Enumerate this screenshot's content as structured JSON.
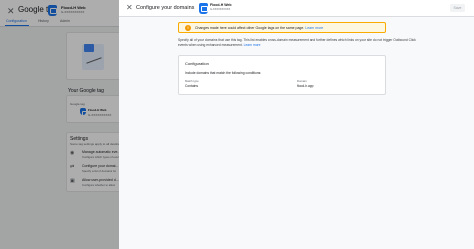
{
  "background": {
    "app_title": "Google tag",
    "site_name": "Flood-H Web",
    "site_id": "G-XXXXXXXXXX",
    "tabs": [
      {
        "label": "Configuration",
        "active": true
      },
      {
        "label": "History",
        "active": false
      },
      {
        "label": "Admin",
        "active": false
      }
    ],
    "your_tag_heading": "Your Google tag",
    "tag_id_label": "Google tag",
    "tag_name": "Flood-H Web",
    "tag_id": "G-XXXXXXXXXX",
    "settings_heading": "Settings",
    "settings_sub": "Some tag settings apply to all destinations",
    "settings_items": [
      {
        "title": "Manage automatic eve...",
        "desc": "Configure which types of events"
      },
      {
        "title": "Configure your domai...",
        "desc": "Specify a list of domains for"
      },
      {
        "title": "Allow user-provided d...",
        "desc": "Configure whether to allow"
      }
    ]
  },
  "panel": {
    "title": "Configure your domains",
    "site_name": "Flood-H Web",
    "site_id": "G-XXXXXXXXXX",
    "save_label": "Save",
    "warning_text": "Changes made here could affect other Google tags on the same page.",
    "warning_link": "Learn more",
    "description": "Specify all of your domains that use this tag. This list enables cross-domain measurement and further defines which links on your site do not trigger Outbound Click events when using enhanced measurement.",
    "description_link": "Learn more",
    "config": {
      "title": "Configuration",
      "subtitle": "Include domains that match the following conditions:",
      "match_type_header": "Match type",
      "match_type_value": "Contains",
      "domain_header": "Domain",
      "domain_value": "flood-h.app"
    }
  },
  "colors": {
    "accent": "#1a73e8",
    "warning_border": "#f9ab00",
    "warning_bg": "#fef7e0"
  }
}
